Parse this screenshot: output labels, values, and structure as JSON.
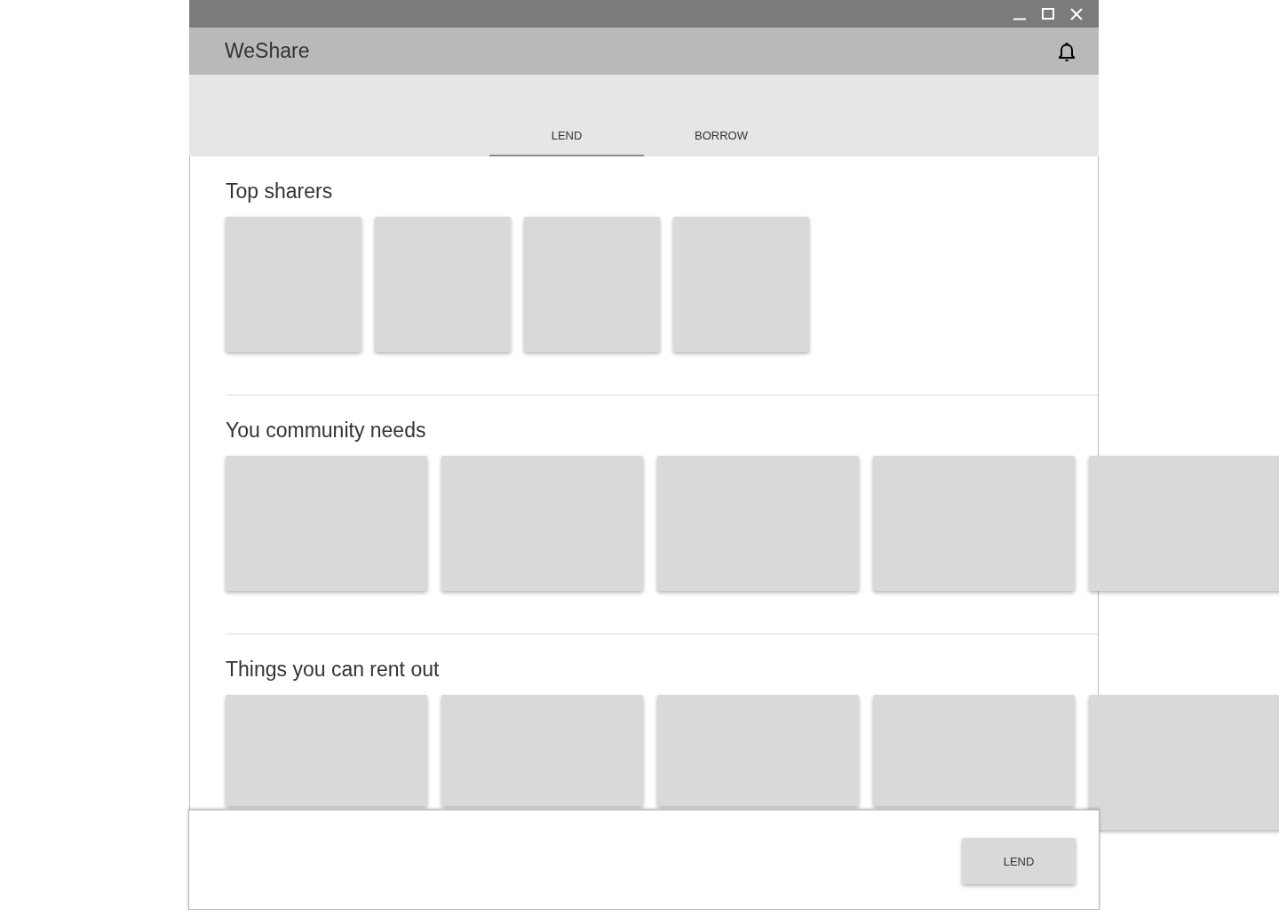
{
  "app_bar": {
    "title": "WeShare"
  },
  "tabs": [
    {
      "label": "LEND",
      "selected": true
    },
    {
      "label": "BORROW",
      "selected": false
    }
  ],
  "sections": [
    {
      "title": "Top sharers",
      "cards": [
        {
          "kind": "square"
        },
        {
          "kind": "square"
        },
        {
          "kind": "square"
        },
        {
          "kind": "square"
        }
      ]
    },
    {
      "title": "You community needs",
      "cards": [
        {
          "kind": "wide"
        },
        {
          "kind": "wide"
        },
        {
          "kind": "wide"
        },
        {
          "kind": "wide"
        },
        {
          "kind": "wide"
        }
      ]
    },
    {
      "title": "Things you can rent out",
      "cards": [
        {
          "kind": "wide-cut"
        },
        {
          "kind": "wide-cut"
        },
        {
          "kind": "wide-cut"
        },
        {
          "kind": "wide-cut"
        },
        {
          "kind": "wide"
        }
      ]
    }
  ],
  "bottom_bar": {
    "button": "LEND"
  }
}
